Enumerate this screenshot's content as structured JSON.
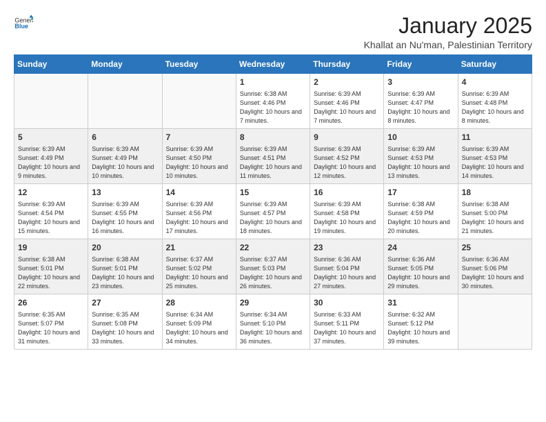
{
  "header": {
    "logo_general": "General",
    "logo_blue": "Blue",
    "month": "January 2025",
    "location": "Khallat an Nu'man, Palestinian Territory"
  },
  "weekdays": [
    "Sunday",
    "Monday",
    "Tuesday",
    "Wednesday",
    "Thursday",
    "Friday",
    "Saturday"
  ],
  "weeks": [
    [
      {
        "day": "",
        "info": ""
      },
      {
        "day": "",
        "info": ""
      },
      {
        "day": "",
        "info": ""
      },
      {
        "day": "1",
        "info": "Sunrise: 6:38 AM\nSunset: 4:46 PM\nDaylight: 10 hours and 7 minutes."
      },
      {
        "day": "2",
        "info": "Sunrise: 6:39 AM\nSunset: 4:46 PM\nDaylight: 10 hours and 7 minutes."
      },
      {
        "day": "3",
        "info": "Sunrise: 6:39 AM\nSunset: 4:47 PM\nDaylight: 10 hours and 8 minutes."
      },
      {
        "day": "4",
        "info": "Sunrise: 6:39 AM\nSunset: 4:48 PM\nDaylight: 10 hours and 8 minutes."
      }
    ],
    [
      {
        "day": "5",
        "info": "Sunrise: 6:39 AM\nSunset: 4:49 PM\nDaylight: 10 hours and 9 minutes."
      },
      {
        "day": "6",
        "info": "Sunrise: 6:39 AM\nSunset: 4:49 PM\nDaylight: 10 hours and 10 minutes."
      },
      {
        "day": "7",
        "info": "Sunrise: 6:39 AM\nSunset: 4:50 PM\nDaylight: 10 hours and 10 minutes."
      },
      {
        "day": "8",
        "info": "Sunrise: 6:39 AM\nSunset: 4:51 PM\nDaylight: 10 hours and 11 minutes."
      },
      {
        "day": "9",
        "info": "Sunrise: 6:39 AM\nSunset: 4:52 PM\nDaylight: 10 hours and 12 minutes."
      },
      {
        "day": "10",
        "info": "Sunrise: 6:39 AM\nSunset: 4:53 PM\nDaylight: 10 hours and 13 minutes."
      },
      {
        "day": "11",
        "info": "Sunrise: 6:39 AM\nSunset: 4:53 PM\nDaylight: 10 hours and 14 minutes."
      }
    ],
    [
      {
        "day": "12",
        "info": "Sunrise: 6:39 AM\nSunset: 4:54 PM\nDaylight: 10 hours and 15 minutes."
      },
      {
        "day": "13",
        "info": "Sunrise: 6:39 AM\nSunset: 4:55 PM\nDaylight: 10 hours and 16 minutes."
      },
      {
        "day": "14",
        "info": "Sunrise: 6:39 AM\nSunset: 4:56 PM\nDaylight: 10 hours and 17 minutes."
      },
      {
        "day": "15",
        "info": "Sunrise: 6:39 AM\nSunset: 4:57 PM\nDaylight: 10 hours and 18 minutes."
      },
      {
        "day": "16",
        "info": "Sunrise: 6:39 AM\nSunset: 4:58 PM\nDaylight: 10 hours and 19 minutes."
      },
      {
        "day": "17",
        "info": "Sunrise: 6:38 AM\nSunset: 4:59 PM\nDaylight: 10 hours and 20 minutes."
      },
      {
        "day": "18",
        "info": "Sunrise: 6:38 AM\nSunset: 5:00 PM\nDaylight: 10 hours and 21 minutes."
      }
    ],
    [
      {
        "day": "19",
        "info": "Sunrise: 6:38 AM\nSunset: 5:01 PM\nDaylight: 10 hours and 22 minutes."
      },
      {
        "day": "20",
        "info": "Sunrise: 6:38 AM\nSunset: 5:01 PM\nDaylight: 10 hours and 23 minutes."
      },
      {
        "day": "21",
        "info": "Sunrise: 6:37 AM\nSunset: 5:02 PM\nDaylight: 10 hours and 25 minutes."
      },
      {
        "day": "22",
        "info": "Sunrise: 6:37 AM\nSunset: 5:03 PM\nDaylight: 10 hours and 26 minutes."
      },
      {
        "day": "23",
        "info": "Sunrise: 6:36 AM\nSunset: 5:04 PM\nDaylight: 10 hours and 27 minutes."
      },
      {
        "day": "24",
        "info": "Sunrise: 6:36 AM\nSunset: 5:05 PM\nDaylight: 10 hours and 29 minutes."
      },
      {
        "day": "25",
        "info": "Sunrise: 6:36 AM\nSunset: 5:06 PM\nDaylight: 10 hours and 30 minutes."
      }
    ],
    [
      {
        "day": "26",
        "info": "Sunrise: 6:35 AM\nSunset: 5:07 PM\nDaylight: 10 hours and 31 minutes."
      },
      {
        "day": "27",
        "info": "Sunrise: 6:35 AM\nSunset: 5:08 PM\nDaylight: 10 hours and 33 minutes."
      },
      {
        "day": "28",
        "info": "Sunrise: 6:34 AM\nSunset: 5:09 PM\nDaylight: 10 hours and 34 minutes."
      },
      {
        "day": "29",
        "info": "Sunrise: 6:34 AM\nSunset: 5:10 PM\nDaylight: 10 hours and 36 minutes."
      },
      {
        "day": "30",
        "info": "Sunrise: 6:33 AM\nSunset: 5:11 PM\nDaylight: 10 hours and 37 minutes."
      },
      {
        "day": "31",
        "info": "Sunrise: 6:32 AM\nSunset: 5:12 PM\nDaylight: 10 hours and 39 minutes."
      },
      {
        "day": "",
        "info": ""
      }
    ]
  ]
}
